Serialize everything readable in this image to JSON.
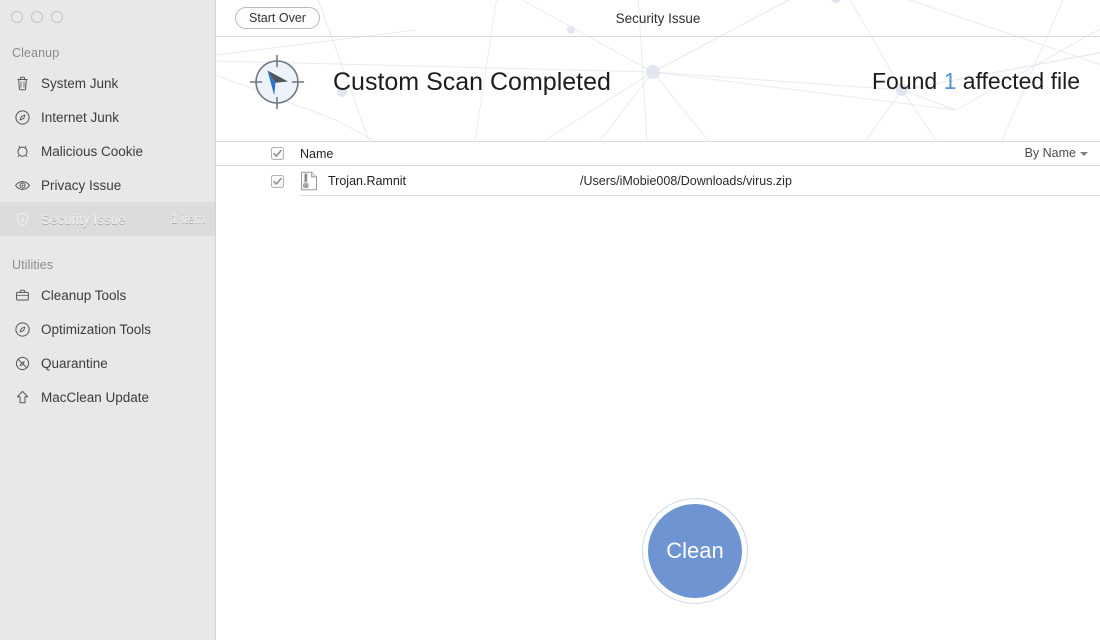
{
  "window": {
    "title": "Security Issue",
    "traffic_lights": [
      "close",
      "minimize",
      "zoom"
    ]
  },
  "toolbar": {
    "start_over_label": "Start Over"
  },
  "sidebar": {
    "groups": [
      {
        "title": "Cleanup",
        "items": [
          {
            "label": "System Junk",
            "icon": "trash-icon",
            "count": "",
            "selected": false
          },
          {
            "label": "Internet Junk",
            "icon": "compass-icon",
            "count": "",
            "selected": false
          },
          {
            "label": "Malicious Cookie",
            "icon": "cookie-icon",
            "count": "",
            "selected": false
          },
          {
            "label": "Privacy Issue",
            "icon": "eye-icon",
            "count": "",
            "selected": false
          },
          {
            "label": "Security Issue",
            "icon": "shield-icon",
            "count": "1 item",
            "selected": true
          }
        ]
      },
      {
        "title": "Utilities",
        "items": [
          {
            "label": "Cleanup Tools",
            "icon": "briefcase-icon",
            "count": "",
            "selected": false
          },
          {
            "label": "Optimization Tools",
            "icon": "compass-icon",
            "count": "",
            "selected": false
          },
          {
            "label": "Quarantine",
            "icon": "no-entry-icon",
            "count": "",
            "selected": false
          },
          {
            "label": "MacClean Update",
            "icon": "up-arrow-icon",
            "count": "",
            "selected": false
          }
        ]
      }
    ]
  },
  "scan": {
    "icon": "compass-icon",
    "title": "Custom Scan Completed",
    "found_prefix": "Found ",
    "found_count": "1",
    "found_suffix": " affected file"
  },
  "table": {
    "select_all_checked": true,
    "column_name": "Name",
    "sort_label": "By Name",
    "sort_icon": "chevron-down-icon",
    "rows": [
      {
        "checked": true,
        "icon": "zip-file-warning-icon",
        "name": "Trojan.Ramnit",
        "path": "/Users/iMobie008/Downloads/virus.zip"
      }
    ]
  },
  "action": {
    "clean_label": "Clean"
  },
  "colors": {
    "accent_blue": "#5b8ed6",
    "clean_button": "#6e95d1",
    "sidebar_bg": "#e8e8e8",
    "selected_row": "#dcdcdc"
  }
}
